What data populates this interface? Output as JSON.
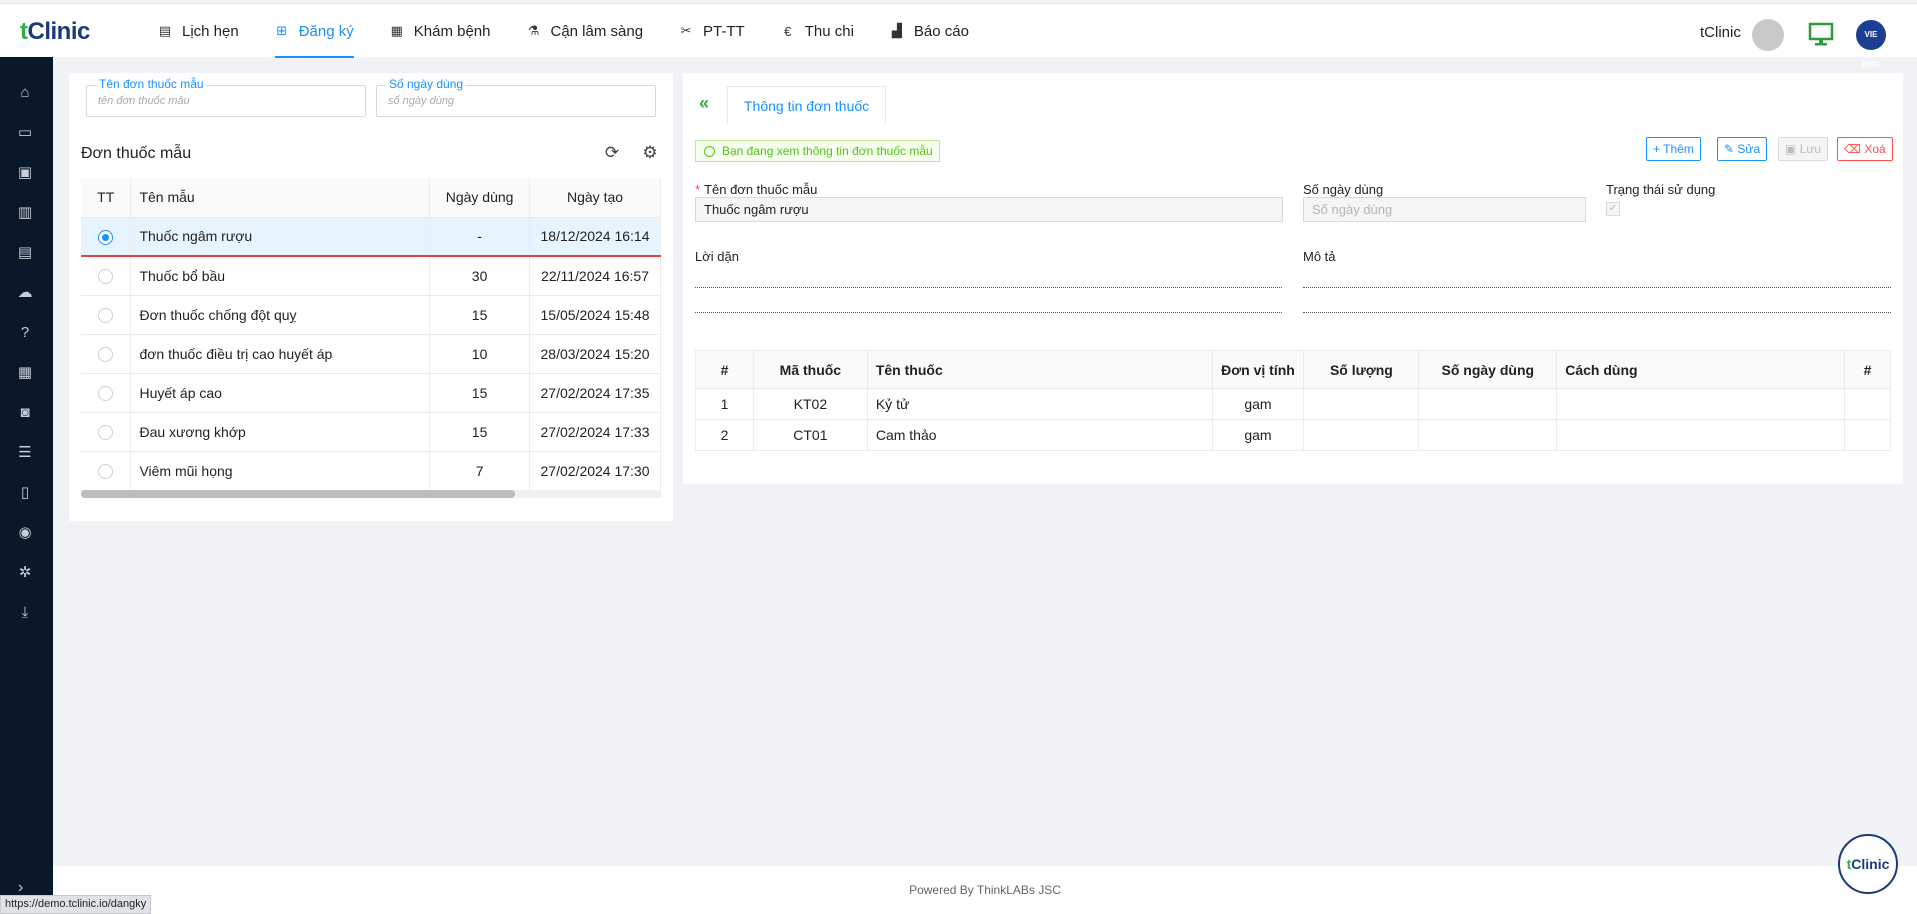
{
  "app": {
    "logo_text": "Clinic",
    "logo_prefix": "t",
    "user_name": "tClinic",
    "lang_badge": "VIE ENG"
  },
  "nav": [
    {
      "label": "Lịch hẹn",
      "icon": "calendar-icon"
    },
    {
      "label": "Đăng ký",
      "icon": "register-icon",
      "active": true
    },
    {
      "label": "Khám bệnh",
      "icon": "clipboard-icon"
    },
    {
      "label": "Cận lâm sàng",
      "icon": "flask-icon"
    },
    {
      "label": "PT-TT",
      "icon": "scissors-icon"
    },
    {
      "label": "Thu chi",
      "icon": "euro-icon"
    },
    {
      "label": "Báo cáo",
      "icon": "chart-icon"
    }
  ],
  "sidebar_icons": [
    "home-icon",
    "id-card-icon",
    "image-icon",
    "store-icon",
    "list-card-icon",
    "upload-cloud-icon",
    "help-icon",
    "profile-card-icon",
    "money-icon",
    "list-icon",
    "document-icon",
    "user-circle-icon",
    "cogs-icon",
    "download-icon",
    "expand-icon"
  ],
  "filters": {
    "name_label": "Tên đơn thuốc mẫu",
    "name_placeholder": "tên đơn thuốc mẫu",
    "days_label": "Số ngày dùng",
    "days_placeholder": "số ngày dùng"
  },
  "list_panel": {
    "title": "Đơn thuốc mẫu",
    "columns": [
      "TT",
      "Tên mẫu",
      "Ngày dùng",
      "Ngày tạo"
    ],
    "rows": [
      {
        "name": "Thuốc ngâm rượu",
        "days": "-",
        "created": "18/12/2024 16:14",
        "selected": true
      },
      {
        "name": "Thuốc bổ bầu",
        "days": "30",
        "created": "22/11/2024 16:57"
      },
      {
        "name": "Đơn thuốc chống đột quỵ",
        "days": "15",
        "created": "15/05/2024 15:48"
      },
      {
        "name": "đơn thuốc điều trị cao huyết áp",
        "days": "10",
        "created": "28/03/2024 15:20"
      },
      {
        "name": "Huyết áp cao",
        "days": "15",
        "created": "27/02/2024 17:35"
      },
      {
        "name": "Đau xương khớp",
        "days": "15",
        "created": "27/02/2024 17:33"
      },
      {
        "name": "Viêm mũi họng",
        "days": "7",
        "created": "27/02/2024 17:30"
      }
    ]
  },
  "detail": {
    "tab_label": "Thông tin đơn thuốc",
    "notice": "Bạn đang xem thông tin đơn thuốc mẫu",
    "buttons": {
      "add": "Thêm",
      "edit": "Sửa",
      "save": "Lưu",
      "delete": "Xoá"
    },
    "name_label": "Tên đơn thuốc mẫu",
    "name_value": "Thuốc ngâm rượu",
    "days_label": "Số ngày dùng",
    "days_placeholder": "Số ngày dùng",
    "status_label": "Trạng thái sử dụng",
    "status_checked": true,
    "advice_label": "Lời dặn",
    "desc_label": "Mô tả",
    "columns": [
      "#",
      "Mã thuốc",
      "Tên thuốc",
      "Đơn vị tính",
      "Số lượng",
      "Số ngày dùng",
      "Cách dùng",
      "#"
    ],
    "rows": [
      {
        "no": "1",
        "code": "KT02",
        "name": "Kỷ tử",
        "unit": "gam",
        "qty": "",
        "days": "",
        "usage": ""
      },
      {
        "no": "2",
        "code": "CT01",
        "name": "Cam thảo",
        "unit": "gam",
        "qty": "",
        "days": "",
        "usage": ""
      }
    ]
  },
  "footer": {
    "text": "Powered By ThinkLABs JSC"
  },
  "status_url": "https://demo.tclinic.io/dangky",
  "colors": {
    "primary": "#1890ff",
    "sidebar": "#0a1929",
    "brand_green": "#2fae4a",
    "brand_blue": "#1a3b7a",
    "danger": "#ff4d4f"
  }
}
